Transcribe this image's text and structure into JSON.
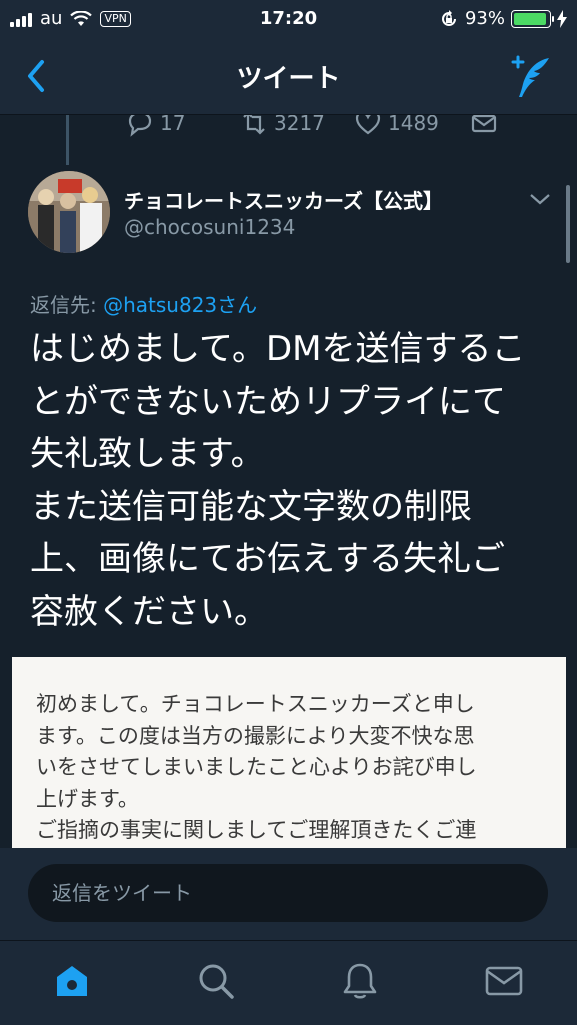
{
  "status_bar": {
    "carrier": "au",
    "vpn": "VPN",
    "time": "17:20",
    "battery_percent": "93%",
    "battery_level": 0.93,
    "icons": [
      "signal-icon",
      "wifi-icon",
      "rotation-lock-icon",
      "battery-icon",
      "charging-icon"
    ]
  },
  "nav": {
    "title": "ツイート",
    "back_icon": "chevron-left-icon",
    "compose_icon": "compose-tweet-icon"
  },
  "previous_tweet_actions": {
    "reply_count": "17",
    "retweet_count": "3217",
    "like_count": "1489"
  },
  "tweet": {
    "display_name": "チョコレートスニッカーズ【公式】",
    "handle": "@chocosuni1234",
    "reply_to_label": "返信先:",
    "reply_to_mention": "@hatsu823さん",
    "paragraphs": [
      "はじめまして。DMを送信するこ\nとができないためリプライにて\n失礼致します。",
      "また送信可能な文字数の制限\n上、画像にてお伝えする失礼ご\n容赦ください。"
    ],
    "image_text": "初めまして。チョコレートスニッカーズと申し\nます。この度は当方の撮影により大変不快な思\nいをさせてしまいましたこと心よりお詫び申し\n上げます。\nご指摘の事実に関しましてご理解頂きたくご連"
  },
  "reply_bar": {
    "placeholder": "返信をツイート"
  },
  "tab_bar": {
    "tabs": [
      "home-icon",
      "search-icon",
      "notifications-icon",
      "messages-icon"
    ]
  },
  "colors": {
    "background": "#15202b",
    "bar": "#1c2938",
    "accent": "#1da1f2",
    "secondary_text": "#8899a6"
  }
}
